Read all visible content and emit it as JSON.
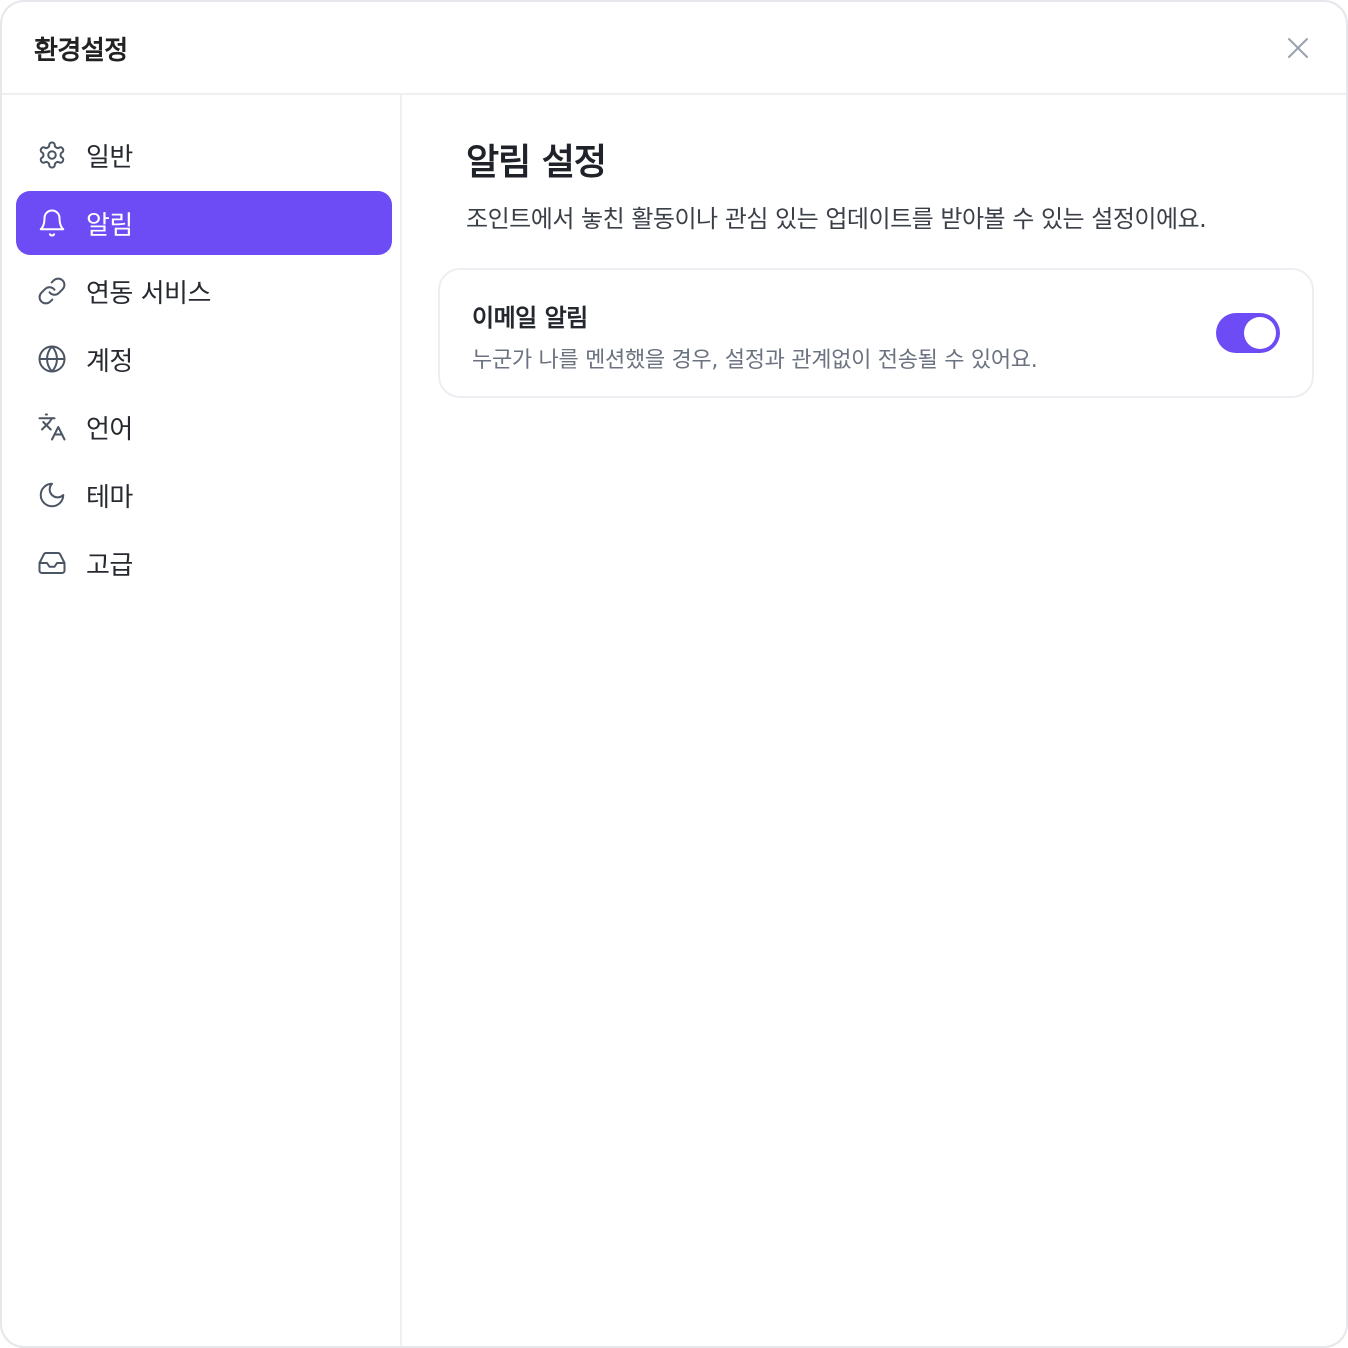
{
  "window": {
    "title": "환경설정",
    "close_icon": "close-icon"
  },
  "sidebar": {
    "items": [
      {
        "label": "일반",
        "icon": "gear-icon",
        "active": false
      },
      {
        "label": "알림",
        "icon": "bell-icon",
        "active": true
      },
      {
        "label": "연동 서비스",
        "icon": "link-icon",
        "active": false
      },
      {
        "label": "계정",
        "icon": "globe-icon",
        "active": false
      },
      {
        "label": "언어",
        "icon": "translate-icon",
        "active": false
      },
      {
        "label": "테마",
        "icon": "moon-icon",
        "active": false
      },
      {
        "label": "고급",
        "icon": "inbox-icon",
        "active": false
      }
    ]
  },
  "main": {
    "title": "알림 설정",
    "description": "조인트에서 놓친 활동이나 관심 있는 업데이트를 받아볼 수 있는 설정이에요.",
    "settings": [
      {
        "title": "이메일 알림",
        "description": "누군가 나를 멘션했을 경우, 설정과 관계없이 전송될 수 있어요.",
        "enabled": true
      }
    ]
  },
  "colors": {
    "accent": "#6d4cf5",
    "icon_default": "#4b5563",
    "border": "#eceef1"
  }
}
